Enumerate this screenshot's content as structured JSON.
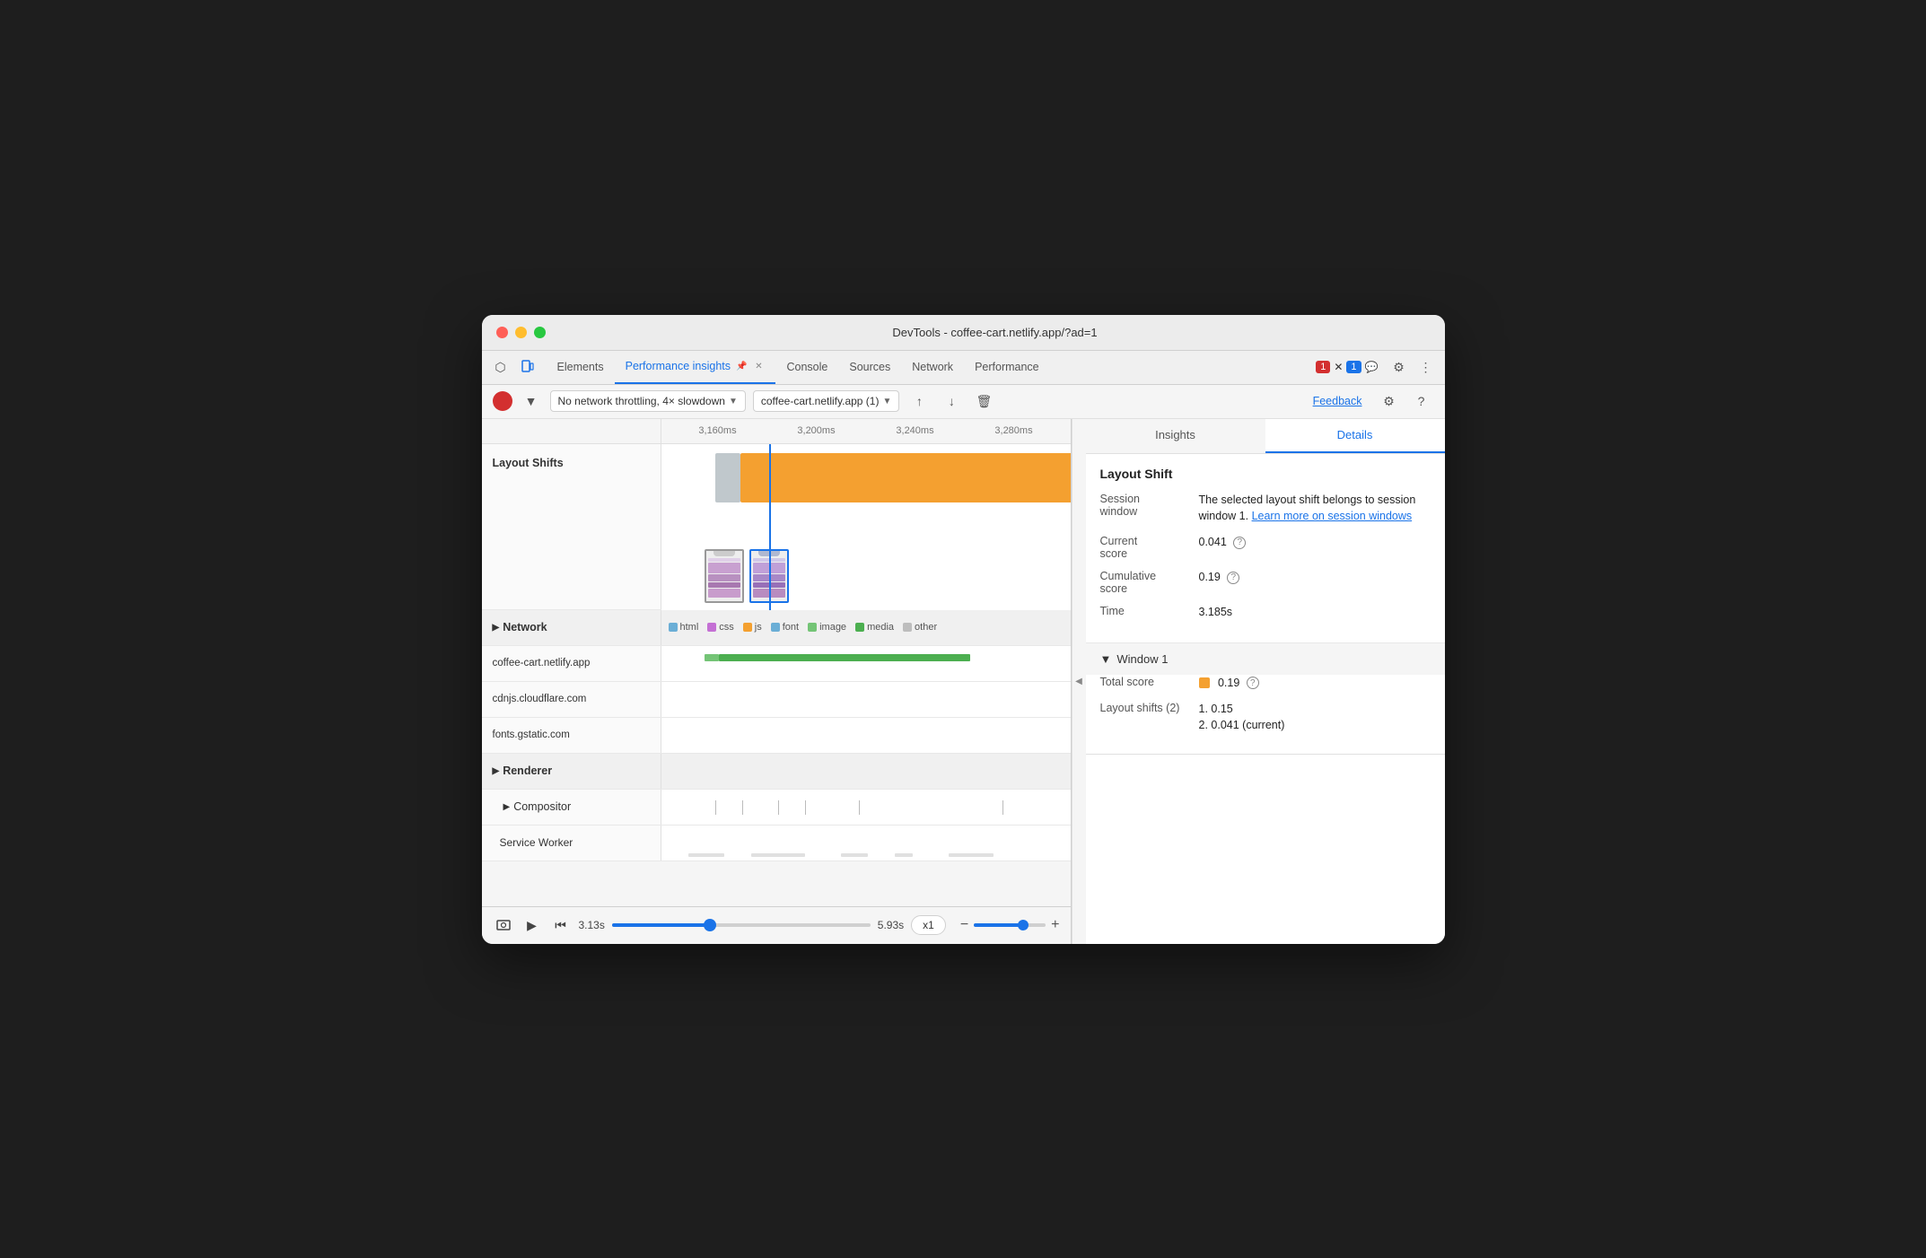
{
  "window": {
    "title": "DevTools - coffee-cart.netlify.app/?ad=1"
  },
  "tabs": [
    {
      "label": "Elements",
      "active": false
    },
    {
      "label": "Performance insights",
      "active": true,
      "pinned": true
    },
    {
      "label": "Console",
      "active": false
    },
    {
      "label": "Sources",
      "active": false
    },
    {
      "label": "Network",
      "active": false
    },
    {
      "label": "Performance",
      "active": false
    }
  ],
  "toolbar": {
    "throttle_label": "No network throttling, 4× slowdown",
    "url_label": "coffee-cart.netlify.app (1)",
    "feedback_label": "Feedback"
  },
  "timeline": {
    "ticks": [
      "3,160ms",
      "3,200ms",
      "3,240ms",
      "3,280ms"
    ]
  },
  "tracks": {
    "layout_shifts_label": "Layout Shifts",
    "network_label": "Network",
    "network_rows": [
      {
        "label": "coffee-cart.netlify.app"
      },
      {
        "label": "cdnjs.cloudflare.com"
      },
      {
        "label": "fonts.gstatic.com"
      }
    ],
    "renderer_label": "Renderer",
    "compositor_label": "Compositor",
    "service_worker_label": "Service Worker"
  },
  "legend": {
    "items": [
      {
        "label": "html",
        "color": "#6baed6"
      },
      {
        "label": "css",
        "color": "#c470d4"
      },
      {
        "label": "js",
        "color": "#f4a030"
      },
      {
        "label": "font",
        "color": "#6baed6"
      },
      {
        "label": "image",
        "color": "#74c476"
      },
      {
        "label": "media",
        "color": "#4caf50"
      },
      {
        "label": "other",
        "color": "#bdbdbd"
      }
    ]
  },
  "playback": {
    "time_start": "3.13s",
    "time_end": "5.93s",
    "scrubber_pct": 38,
    "speed_label": "x1",
    "zoom_pct": 68
  },
  "right_panel": {
    "tabs": [
      {
        "label": "Insights"
      },
      {
        "label": "Details",
        "active": true
      }
    ],
    "detail_title": "Layout Shift",
    "session_window_label": "Session window",
    "session_window_value": "The selected layout shift belongs to session window 1.",
    "learn_more_label": "Learn more on",
    "session_windows_label": "session windows",
    "current_score_label": "Current score",
    "current_score_value": "0.041",
    "cumulative_score_label": "Cumulative score",
    "cumulative_score_value": "0.19",
    "time_label": "Time",
    "time_value": "3.185s",
    "window1_label": "Window 1",
    "total_score_label": "Total score",
    "total_score_value": "0.19",
    "layout_shifts_label": "Layout shifts (2)",
    "layout_shifts_value1": "1. 0.15",
    "layout_shifts_value2": "2. 0.041 (current)"
  },
  "badges": {
    "errors": "1",
    "messages": "1"
  }
}
